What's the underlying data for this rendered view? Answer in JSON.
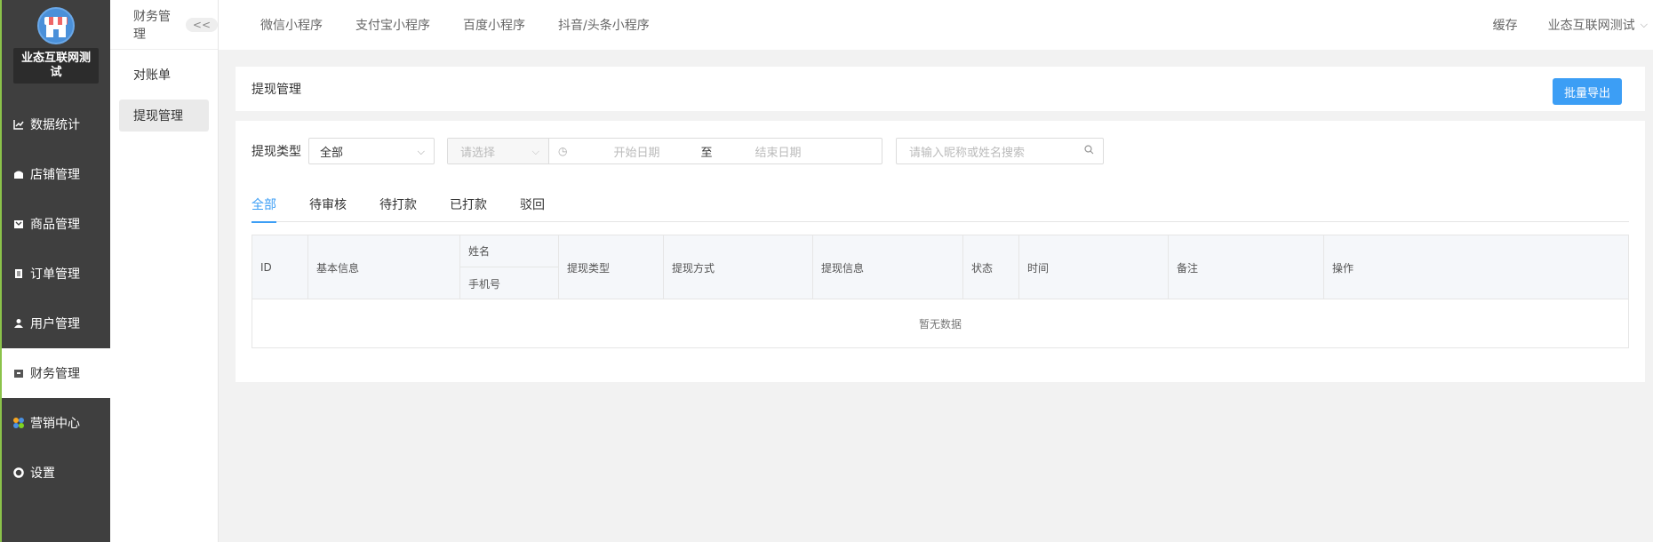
{
  "store": {
    "name": "业态互联网测试"
  },
  "sidebar": {
    "items": [
      {
        "label": "数据统计",
        "icon": "chart-icon"
      },
      {
        "label": "店铺管理",
        "icon": "store-icon"
      },
      {
        "label": "商品管理",
        "icon": "box-icon"
      },
      {
        "label": "订单管理",
        "icon": "clipboard-icon"
      },
      {
        "label": "用户管理",
        "icon": "user-icon"
      },
      {
        "label": "财务管理",
        "icon": "wallet-icon",
        "active": true
      },
      {
        "label": "营销中心",
        "icon": "flower-icon"
      },
      {
        "label": "设置",
        "icon": "gear-icon"
      }
    ]
  },
  "subnav": {
    "title": "财务管理",
    "collapse_label": "<<",
    "items": [
      {
        "label": "对账单"
      },
      {
        "label": "提现管理",
        "active": true
      }
    ]
  },
  "topbar": {
    "tabs": [
      "微信小程序",
      "支付宝小程序",
      "百度小程序",
      "抖音/头条小程序"
    ],
    "cache_label": "缓存",
    "user_label": "业态互联网测试"
  },
  "page": {
    "title": "提现管理",
    "export_label": "批量导出"
  },
  "filters": {
    "type_label": "提现类型",
    "type_value": "全部",
    "date_select_placeholder": "请选择",
    "start_placeholder": "开始日期",
    "range_separator": "至",
    "end_placeholder": "结束日期",
    "search_placeholder": "请输入昵称或姓名搜索"
  },
  "tabs": [
    "全部",
    "待审核",
    "待打款",
    "已打款",
    "驳回"
  ],
  "table": {
    "columns": {
      "id": "ID",
      "basic": "基本信息",
      "name": "姓名",
      "phone": "手机号",
      "type": "提现类型",
      "method": "提现方式",
      "info": "提现信息",
      "status": "状态",
      "time": "时间",
      "remark": "备注",
      "action": "操作"
    },
    "empty_text": "暂无数据"
  },
  "colors": {
    "accent": "#3c9ef5",
    "sidebar_bg": "#3f3f3f"
  }
}
